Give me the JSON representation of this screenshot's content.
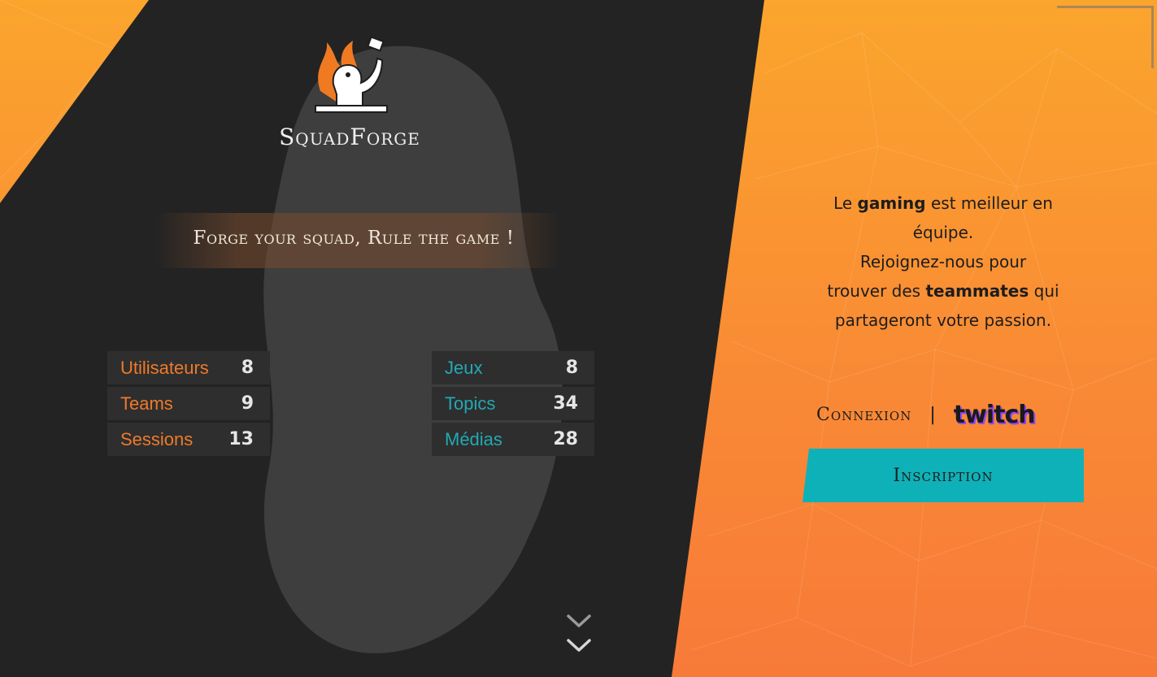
{
  "brand": {
    "name": "SquadForge",
    "tagline": "Forge your squad, Rule the game !"
  },
  "stats_left": [
    {
      "label": "Utilisateurs",
      "value": "8"
    },
    {
      "label": "Teams",
      "value": "9"
    },
    {
      "label": "Sessions",
      "value": "13"
    }
  ],
  "stats_right": [
    {
      "label": "Jeux",
      "value": "8"
    },
    {
      "label": "Topics",
      "value": "34"
    },
    {
      "label": "Médias",
      "value": "28"
    }
  ],
  "intro": {
    "le": "Le ",
    "gaming": "gaming",
    "after_gaming": " est meilleur en",
    "line2": "équipe.",
    "line3": "Rejoignez-nous pour",
    "line4_a": "trouver des ",
    "teammates": "teammates",
    "line4_b": " qui",
    "line5": "partageront votre passion."
  },
  "auth": {
    "login_label": "Connexion",
    "separator": "|",
    "twitch_label": "twitch",
    "signup_label": "Inscription"
  },
  "colors": {
    "orange": "#f98a35",
    "dark": "#232323",
    "teal": "#0fb1b8",
    "orange_text": "#ef7a2a",
    "teal_text": "#22a9b3",
    "twitch_purple": "#9146ff"
  },
  "icons": {
    "logo": "blacksmith-hammer-logo-icon",
    "scroll": "double-chevron-down-icon"
  }
}
